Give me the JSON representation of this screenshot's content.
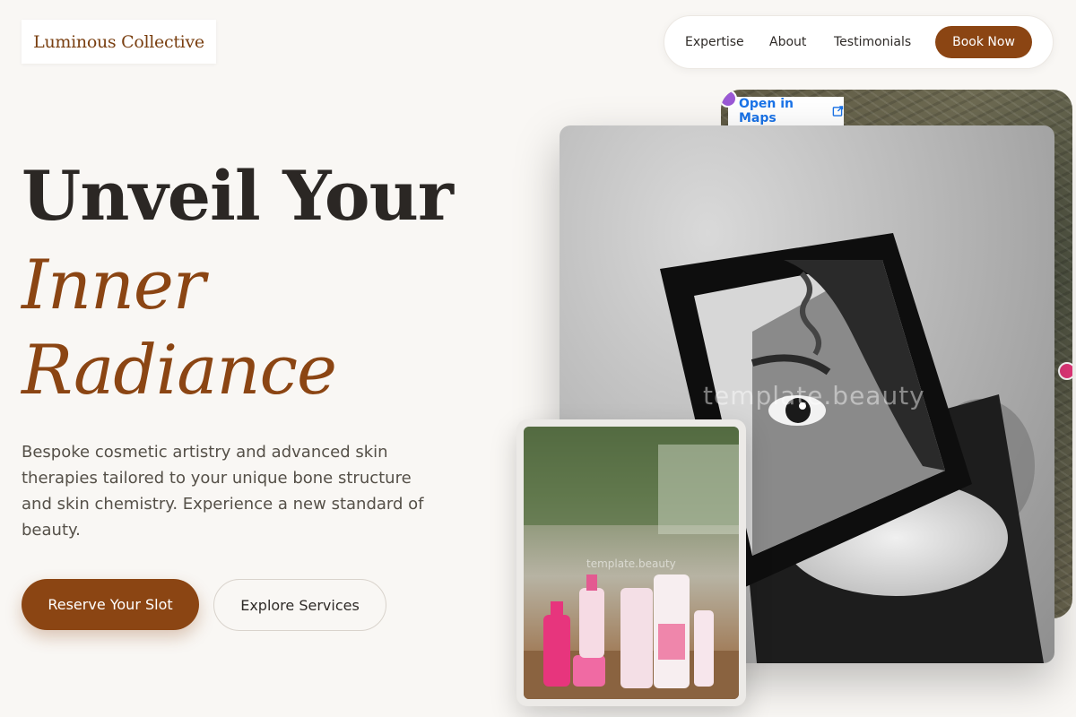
{
  "brand": {
    "name": "Luminous Collective"
  },
  "nav": {
    "links": [
      "Expertise",
      "About",
      "Testimonials"
    ],
    "cta": "Book Now"
  },
  "hero": {
    "line1": "Unveil Your",
    "line2": "Inner",
    "line3": "Radiance",
    "description": "Bespoke cosmetic artistry and advanced skin therapies tailored to your unique bone structure and skin chemistry. Experience a new standard of beauty.",
    "primary_cta": "Reserve Your Slot",
    "secondary_cta": "Explore Services"
  },
  "map": {
    "open_link": "Open in Maps"
  },
  "images": {
    "watermark": "template.beauty"
  },
  "colors": {
    "accent": "#8b4513",
    "background": "#f9f7f4",
    "link": "#1a73e8"
  }
}
